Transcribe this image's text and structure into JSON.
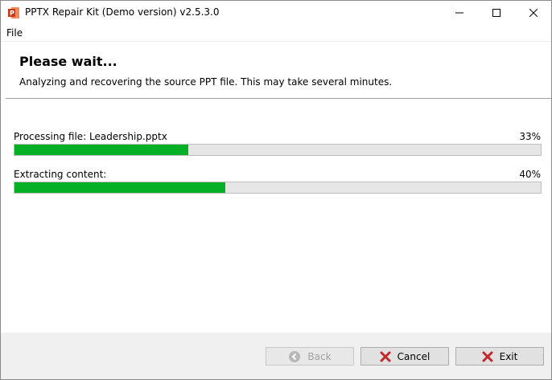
{
  "window": {
    "title": "PPTX Repair Kit (Demo version) v2.5.3.0"
  },
  "menu": {
    "file": "File"
  },
  "header": {
    "title": "Please wait...",
    "description": "Analyzing and recovering the source PPT file. This may take several minutes."
  },
  "progress": [
    {
      "label": "Processing file: Leadership.pptx",
      "percent_text": "33%",
      "value": 33
    },
    {
      "label": "Extracting content:",
      "percent_text": "40%",
      "value": 40
    }
  ],
  "buttons": {
    "back": "Back",
    "cancel": "Cancel",
    "exit": "Exit"
  },
  "icons": {
    "app": "powerpoint-icon",
    "back": "back-arrow-icon",
    "cancel": "red-x-icon",
    "exit": "red-x-icon"
  },
  "colors": {
    "progress_fill": "#06b025",
    "cancel_icon": "#c0282d"
  }
}
